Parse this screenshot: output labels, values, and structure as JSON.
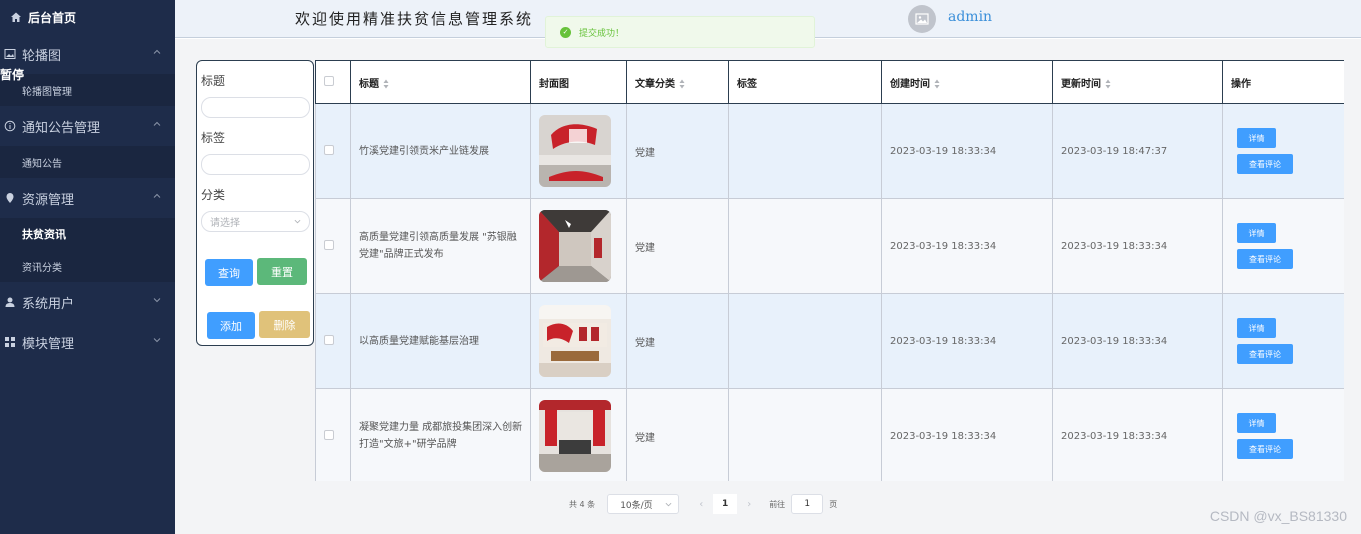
{
  "sidebar": {
    "home": "后台首页",
    "pause": "暂停",
    "groups": [
      {
        "label": "轮播图",
        "icon": "image-icon",
        "items": [
          "轮播图管理"
        ]
      },
      {
        "label": "通知公告管理",
        "icon": "info-icon",
        "items": [
          "通知公告"
        ]
      },
      {
        "label": "资源管理",
        "icon": "location-icon",
        "items": [
          "扶贫资讯",
          "资讯分类"
        ]
      },
      {
        "label": "系统用户",
        "icon": "user-icon",
        "items": []
      },
      {
        "label": "模块管理",
        "icon": "grid-icon",
        "items": []
      }
    ]
  },
  "header": {
    "title": "欢迎使用精准扶贫信息管理系统",
    "username": "admin"
  },
  "toast": {
    "message": "提交成功！"
  },
  "filter": {
    "title_label": "标题",
    "tag_label": "标签",
    "category_label": "分类",
    "category_placeholder": "请选择",
    "query_button": "查询",
    "reset_button": "重置",
    "add_button": "添加",
    "delete_button": "删除"
  },
  "table": {
    "headers": {
      "title": "标题",
      "cover": "封面图",
      "category": "文章分类",
      "tags": "标签",
      "created": "创建时间",
      "updated": "更新时间",
      "actions": "操作"
    },
    "rows": [
      {
        "title": "竹溪党建引领贡米产业链发展",
        "category": "党建",
        "tags": "",
        "created": "2023-03-19 18:33:34",
        "updated": "2023-03-19 18:47:37",
        "detail": "详情",
        "comments": "查看评论"
      },
      {
        "title": "高质量党建引领高质量发展 \"苏银融党建\"品牌正式发布",
        "category": "党建",
        "tags": "",
        "created": "2023-03-19 18:33:34",
        "updated": "2023-03-19 18:33:34",
        "detail": "详情",
        "comments": "查看评论"
      },
      {
        "title": "以高质量党建赋能基层治理",
        "category": "党建",
        "tags": "",
        "created": "2023-03-19 18:33:34",
        "updated": "2023-03-19 18:33:34",
        "detail": "详情",
        "comments": "查看评论"
      },
      {
        "title": "凝聚党建力量 成都旅投集团深入创新打造\"文旅+\"研学品牌",
        "category": "党建",
        "tags": "",
        "created": "2023-03-19 18:33:34",
        "updated": "2023-03-19 18:33:34",
        "detail": "详情",
        "comments": "查看评论"
      }
    ]
  },
  "pagination": {
    "total": "共 4 条",
    "page_size": "10条/页",
    "current": "1",
    "goto_label": "前往",
    "goto_value": "1",
    "page_suffix": "页"
  },
  "watermark": "CSDN @vx_BS81330",
  "colors": {
    "sidebar_bg": "#1e2c4a",
    "primary": "#409eff",
    "success": "#5cb87a",
    "warning": "#e0c27a",
    "accent_blue": "#3b8fd9"
  }
}
